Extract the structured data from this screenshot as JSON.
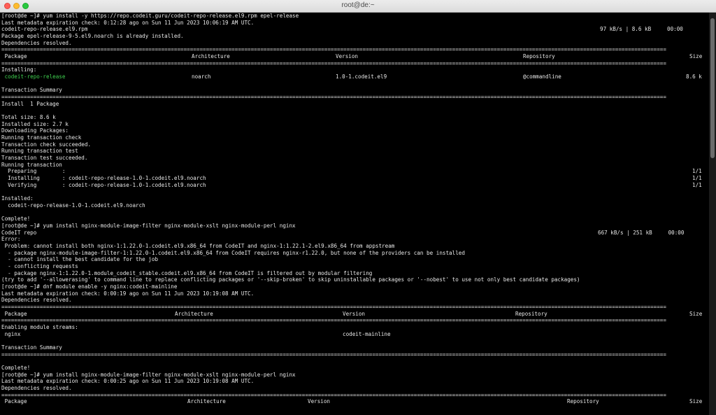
{
  "window": {
    "title": "root@de:~"
  },
  "terminal": {
    "lines": [
      {
        "cols": [
          {
            "text": "[root@de ~]# yum install -y https://repo.codeit.guru/codeit-repo-release.el9.rpm epel-release"
          }
        ]
      },
      {
        "cols": [
          {
            "text": "Last metadata expiration check: 0:12:28 ago on Sun 11 Jun 2023 10:06:19 AM UTC."
          }
        ]
      },
      {
        "cols": [
          {
            "text": "codeit-repo-release.el9.rpm"
          },
          {
            "text": "97 kB/s | 8.6 kB     00:00",
            "at": 858
          }
        ]
      },
      {
        "cols": [
          {
            "text": "Package epel-release-9-5.el9.noarch is already installed."
          }
        ]
      },
      {
        "cols": [
          {
            "text": "Dependencies resolved."
          }
        ]
      },
      {
        "cols": [
          {
            "text": "================================================================================================================================================================================================================"
          }
        ]
      },
      {
        "cols": [
          {
            "text": " Package"
          },
          {
            "text": "Architecture",
            "at": 274
          },
          {
            "text": "Version",
            "at": 480
          },
          {
            "text": "Repository",
            "at": 748
          },
          {
            "text": "Size",
            "at": 986
          }
        ]
      },
      {
        "cols": [
          {
            "text": "================================================================================================================================================================================================================"
          }
        ]
      },
      {
        "cols": [
          {
            "text": "Installing:"
          }
        ]
      },
      {
        "cols": [
          {
            "text": " codeit-repo-release",
            "green": true
          },
          {
            "text": "noarch",
            "at": 274
          },
          {
            "text": "1.0-1.codeit.el9",
            "at": 480
          },
          {
            "text": "@commandline",
            "at": 748
          },
          {
            "text": "8.6 k",
            "at": 981
          }
        ]
      },
      {
        "cols": [
          {
            "text": ""
          }
        ]
      },
      {
        "cols": [
          {
            "text": "Transaction Summary"
          }
        ]
      },
      {
        "cols": [
          {
            "text": "================================================================================================================================================================================================================"
          }
        ]
      },
      {
        "cols": [
          {
            "text": "Install  1 Package"
          }
        ]
      },
      {
        "cols": [
          {
            "text": ""
          }
        ]
      },
      {
        "cols": [
          {
            "text": "Total size: 8.6 k"
          }
        ]
      },
      {
        "cols": [
          {
            "text": "Installed size: 2.7 k"
          }
        ]
      },
      {
        "cols": [
          {
            "text": "Downloading Packages:"
          }
        ]
      },
      {
        "cols": [
          {
            "text": "Running transaction check"
          }
        ]
      },
      {
        "cols": [
          {
            "text": "Transaction check succeeded."
          }
        ]
      },
      {
        "cols": [
          {
            "text": "Running transaction test"
          }
        ]
      },
      {
        "cols": [
          {
            "text": "Transaction test succeeded."
          }
        ]
      },
      {
        "cols": [
          {
            "text": "Running transaction"
          }
        ]
      },
      {
        "cols": [
          {
            "text": "  Preparing        :"
          },
          {
            "text": "1/1",
            "at": 990
          }
        ]
      },
      {
        "cols": [
          {
            "text": "  Installing       : codeit-repo-release-1.0-1.codeit.el9.noarch"
          },
          {
            "text": "1/1",
            "at": 990
          }
        ]
      },
      {
        "cols": [
          {
            "text": "  Verifying        : codeit-repo-release-1.0-1.codeit.el9.noarch"
          },
          {
            "text": "1/1",
            "at": 990
          }
        ]
      },
      {
        "cols": [
          {
            "text": ""
          }
        ]
      },
      {
        "cols": [
          {
            "text": "Installed:"
          }
        ]
      },
      {
        "cols": [
          {
            "text": "  codeit-repo-release-1.0-1.codeit.el9.noarch"
          }
        ]
      },
      {
        "cols": [
          {
            "text": ""
          }
        ]
      },
      {
        "cols": [
          {
            "text": "Complete!"
          }
        ]
      },
      {
        "cols": [
          {
            "text": "[root@de ~]# yum install nginx-module-image-filter nginx-module-xslt nginx-module-perl nginx"
          }
        ]
      },
      {
        "cols": [
          {
            "text": "CodeIT repo"
          },
          {
            "text": "667 kB/s | 251 kB     00:00",
            "at": 855
          }
        ]
      },
      {
        "cols": [
          {
            "text": "Error:"
          }
        ]
      },
      {
        "cols": [
          {
            "text": " Problem: cannot install both nginx-1:1.22.0-1.codeit.el9.x86_64 from CodeIT and nginx-1:1.22.1-2.el9.x86_64 from appstream"
          }
        ]
      },
      {
        "cols": [
          {
            "text": "  - package nginx-module-image-filter-1:1.22.0-1.codeit.el9.x86_64 from CodeIT requires nginx-r1.22.0, but none of the providers can be installed"
          }
        ]
      },
      {
        "cols": [
          {
            "text": "  - cannot install the best candidate for the job"
          }
        ]
      },
      {
        "cols": [
          {
            "text": "  - conflicting requests"
          }
        ]
      },
      {
        "cols": [
          {
            "text": "  - package nginx-1:1.22.0-1.module_codeit_stable.codeit.el9.x86_64 from CodeIT is filtered out by modular filtering"
          }
        ]
      },
      {
        "cols": [
          {
            "text": "(try to add '--allowerasing' to command line to replace conflicting packages or '--skip-broken' to skip uninstallable packages or '--nobest' to use not only best candidate packages)"
          }
        ]
      },
      {
        "cols": [
          {
            "text": "[root@de ~]# dnf module enable -y nginx:codeit-mainline"
          }
        ]
      },
      {
        "cols": [
          {
            "text": "Last metadata expiration check: 0:00:19 ago on Sun 11 Jun 2023 10:19:08 AM UTC."
          }
        ]
      },
      {
        "cols": [
          {
            "text": "Dependencies resolved."
          }
        ]
      },
      {
        "cols": [
          {
            "text": "================================================================================================================================================================================================================"
          }
        ]
      },
      {
        "cols": [
          {
            "text": " Package"
          },
          {
            "text": "Architecture",
            "at": 250
          },
          {
            "text": "Version",
            "at": 490
          },
          {
            "text": "Repository",
            "at": 737
          },
          {
            "text": "Size",
            "at": 986
          }
        ]
      },
      {
        "cols": [
          {
            "text": "================================================================================================================================================================================================================"
          }
        ]
      },
      {
        "cols": [
          {
            "text": "Enabling module streams:"
          }
        ]
      },
      {
        "cols": [
          {
            "text": " nginx"
          },
          {
            "text": "codeit-mainline",
            "at": 490
          }
        ]
      },
      {
        "cols": [
          {
            "text": ""
          }
        ]
      },
      {
        "cols": [
          {
            "text": "Transaction Summary"
          }
        ]
      },
      {
        "cols": [
          {
            "text": "================================================================================================================================================================================================================"
          }
        ]
      },
      {
        "cols": [
          {
            "text": ""
          }
        ]
      },
      {
        "cols": [
          {
            "text": "Complete!"
          }
        ]
      },
      {
        "cols": [
          {
            "text": "[root@de ~]# yum install nginx-module-image-filter nginx-module-xslt nginx-module-perl nginx"
          }
        ]
      },
      {
        "cols": [
          {
            "text": "Last metadata expiration check: 0:00:25 ago on Sun 11 Jun 2023 10:19:08 AM UTC."
          }
        ]
      },
      {
        "cols": [
          {
            "text": "Dependencies resolved."
          }
        ]
      },
      {
        "cols": [
          {
            "text": "================================================================================================================================================================================================================"
          }
        ]
      },
      {
        "cols": [
          {
            "text": " Package"
          },
          {
            "text": "Architecture",
            "at": 268
          },
          {
            "text": "Version",
            "at": 440
          },
          {
            "text": "Repository",
            "at": 811
          },
          {
            "text": "Size",
            "at": 986
          }
        ]
      }
    ]
  }
}
